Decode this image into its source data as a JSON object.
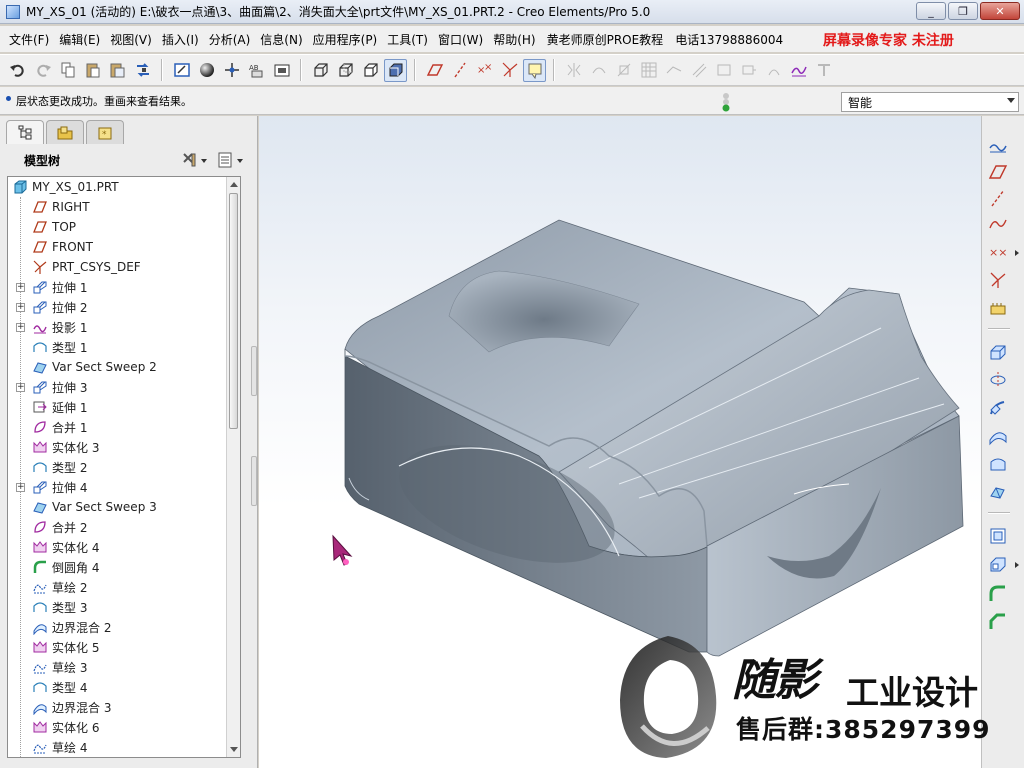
{
  "window": {
    "title": "MY_XS_01 (活动的) E:\\破衣一点通\\3、曲面篇\\2、消失面大全\\prt文件\\MY_XS_01.PRT.2 - Creo Elements/Pro 5.0",
    "minimize": "_",
    "maximize": "❐",
    "close": "✕"
  },
  "menubar": {
    "items": [
      "文件(F)",
      "编辑(E)",
      "视图(V)",
      "插入(I)",
      "分析(A)",
      "信息(N)",
      "应用程序(P)",
      "工具(T)",
      "窗口(W)",
      "帮助(H)"
    ],
    "teacher": "黄老师原创PROE教程",
    "phone": "电话13798886004",
    "promo": "屏幕录像专家  未注册"
  },
  "status": {
    "message": "层状态更改成功。重画来查看结果。",
    "filter": "智能"
  },
  "navigator": {
    "title": "模型树",
    "tree": [
      {
        "label": "MY_XS_01.PRT",
        "icon": "part-icon",
        "expandable": false,
        "root": true
      },
      {
        "label": "RIGHT",
        "icon": "datum-plane-icon",
        "expandable": false
      },
      {
        "label": "TOP",
        "icon": "datum-plane-icon",
        "expandable": false
      },
      {
        "label": "FRONT",
        "icon": "datum-plane-icon",
        "expandable": false
      },
      {
        "label": "PRT_CSYS_DEF",
        "icon": "csys-icon",
        "expandable": false
      },
      {
        "label": "拉伸 1",
        "icon": "extrude-icon",
        "expandable": true
      },
      {
        "label": "拉伸 2",
        "icon": "extrude-icon",
        "expandable": true
      },
      {
        "label": "投影 1",
        "icon": "project-icon",
        "expandable": true
      },
      {
        "label": "类型 1",
        "icon": "surface-icon",
        "expandable": false
      },
      {
        "label": "Var Sect Sweep 2",
        "icon": "sweep-icon",
        "expandable": false
      },
      {
        "label": "拉伸 3",
        "icon": "extrude-icon",
        "expandable": true
      },
      {
        "label": "延伸 1",
        "icon": "extend-icon",
        "expandable": false
      },
      {
        "label": "合并 1",
        "icon": "merge-icon",
        "expandable": false
      },
      {
        "label": "实体化 3",
        "icon": "solidify-icon",
        "expandable": false
      },
      {
        "label": "类型 2",
        "icon": "surface-icon",
        "expandable": false
      },
      {
        "label": "拉伸 4",
        "icon": "extrude-icon",
        "expandable": true
      },
      {
        "label": "Var Sect Sweep 3",
        "icon": "sweep-icon",
        "expandable": false
      },
      {
        "label": "合并 2",
        "icon": "merge-icon",
        "expandable": false
      },
      {
        "label": "实体化 4",
        "icon": "solidify-icon",
        "expandable": false
      },
      {
        "label": "倒圆角 4",
        "icon": "round-icon",
        "expandable": false
      },
      {
        "label": "草绘 2",
        "icon": "sketch-icon",
        "expandable": false
      },
      {
        "label": "类型 3",
        "icon": "surface-icon",
        "expandable": false
      },
      {
        "label": "边界混合 2",
        "icon": "boundary-blend-icon",
        "expandable": false
      },
      {
        "label": "实体化 5",
        "icon": "solidify-icon",
        "expandable": false
      },
      {
        "label": "草绘 3",
        "icon": "sketch-icon",
        "expandable": false
      },
      {
        "label": "类型 4",
        "icon": "surface-icon",
        "expandable": false
      },
      {
        "label": "边界混合 3",
        "icon": "boundary-blend-icon",
        "expandable": false
      },
      {
        "label": "实体化 6",
        "icon": "solidify-icon",
        "expandable": false
      },
      {
        "label": "草绘 4",
        "icon": "sketch-icon",
        "expandable": false
      }
    ]
  },
  "watermark": {
    "signature": "随影",
    "brand": "工业设计",
    "group": "售后群:385297399"
  },
  "colors": {
    "model_top": "#a9b4c0",
    "model_front": "#6f7a86",
    "model_side": "#8c97a3",
    "promo_red": "#e31b1b",
    "accent_blue": "#1a4fb0"
  }
}
